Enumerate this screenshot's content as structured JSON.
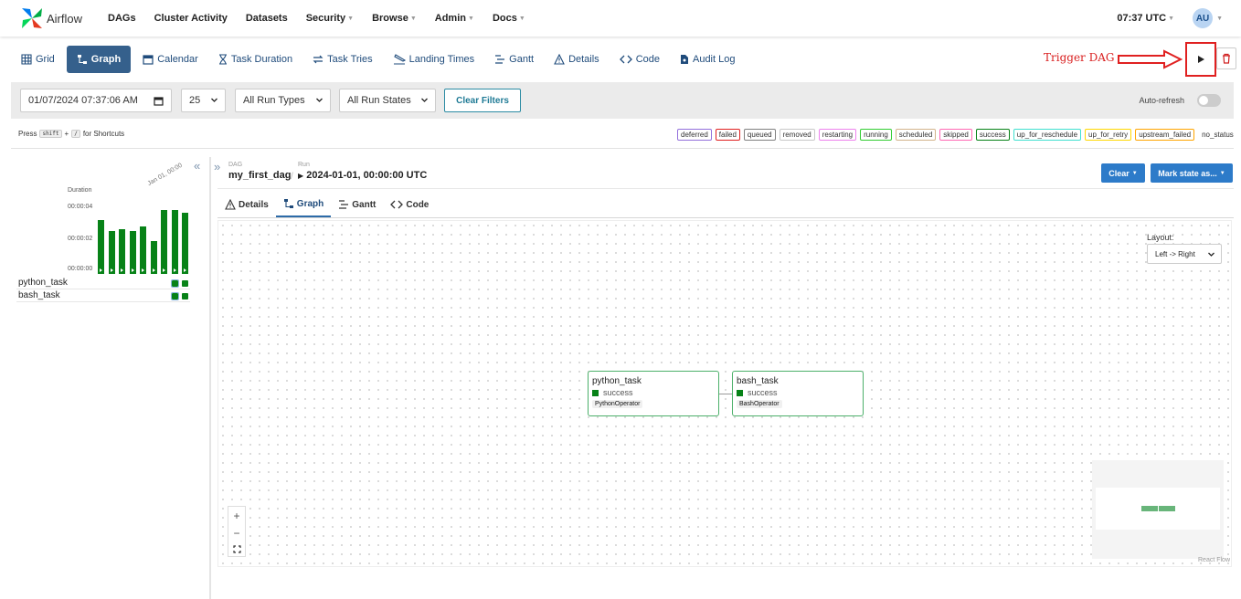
{
  "topnav": {
    "brand": "Airflow",
    "items": [
      {
        "label": "DAGs",
        "caret": false
      },
      {
        "label": "Cluster Activity",
        "caret": false
      },
      {
        "label": "Datasets",
        "caret": false
      },
      {
        "label": "Security",
        "caret": true
      },
      {
        "label": "Browse",
        "caret": true
      },
      {
        "label": "Admin",
        "caret": true
      },
      {
        "label": "Docs",
        "caret": true
      }
    ],
    "time": "07:37 UTC",
    "avatar": "AU"
  },
  "view_tabs": [
    {
      "label": "Grid",
      "icon": "grid-icon",
      "active": false
    },
    {
      "label": "Graph",
      "icon": "graph-icon",
      "active": true
    },
    {
      "label": "Calendar",
      "icon": "calendar-icon",
      "active": false
    },
    {
      "label": "Task Duration",
      "icon": "hourglass-icon",
      "active": false
    },
    {
      "label": "Task Tries",
      "icon": "retry-icon",
      "active": false
    },
    {
      "label": "Landing Times",
      "icon": "plane-landing-icon",
      "active": false
    },
    {
      "label": "Gantt",
      "icon": "gantt-icon",
      "active": false
    },
    {
      "label": "Details",
      "icon": "warning-triangle-icon",
      "active": false
    },
    {
      "label": "Code",
      "icon": "code-icon",
      "active": false
    },
    {
      "label": "Audit Log",
      "icon": "audit-file-icon",
      "active": false
    }
  ],
  "annotation": {
    "label": "Trigger DAG",
    "color": "#d91f1f"
  },
  "filters": {
    "date": "01/07/2024 07:37:06 AM",
    "num_runs": "25",
    "run_type": "All Run Types",
    "run_state": "All Run States",
    "clear_label": "Clear Filters",
    "auto_refresh": "Auto-refresh"
  },
  "shortcuts": {
    "press": "Press",
    "key1": "shift",
    "plus": "+",
    "key2": "/",
    "suffix": "for Shortcuts"
  },
  "legend": [
    {
      "label": "deferred",
      "color": "#9370db"
    },
    {
      "label": "failed",
      "color": "#e02020"
    },
    {
      "label": "queued",
      "color": "#808080"
    },
    {
      "label": "removed",
      "color": "#c8c8c8"
    },
    {
      "label": "restarting",
      "color": "#ee82ee"
    },
    {
      "label": "running",
      "color": "#32cd32"
    },
    {
      "label": "scheduled",
      "color": "#d2b48c"
    },
    {
      "label": "skipped",
      "color": "#ff69b4"
    },
    {
      "label": "success",
      "color": "#078217"
    },
    {
      "label": "up_for_reschedule",
      "color": "#40e0d0"
    },
    {
      "label": "up_for_retry",
      "color": "#ffd700"
    },
    {
      "label": "upstream_failed",
      "color": "#ffa500"
    }
  ],
  "legend_no_status": "no_status",
  "grid": {
    "duration_label": "Duration",
    "yticks": [
      "00:00:04",
      "00:00:02",
      "00:00:00"
    ],
    "date_label": "Jan 01, 00:00",
    "run_durations": [
      3.6,
      2.9,
      3.0,
      2.9,
      3.2,
      2.2,
      4.3,
      4.3,
      4.1
    ],
    "max_duration": 4.8,
    "tasks": [
      {
        "name": "python_task"
      },
      {
        "name": "bash_task"
      }
    ]
  },
  "breadcrumb": {
    "dag_small": "DAG",
    "dag_name": "my_first_dag",
    "run_small": "Run",
    "run_name": "2024-01-01, 00:00:00 UTC"
  },
  "actions": {
    "clear": "Clear",
    "mark": "Mark state as..."
  },
  "sub_tabs": [
    {
      "label": "Details",
      "icon": "warning-triangle-icon",
      "active": false
    },
    {
      "label": "Graph",
      "icon": "graph-icon",
      "active": true
    },
    {
      "label": "Gantt",
      "icon": "gantt-icon",
      "active": false
    },
    {
      "label": "Code",
      "icon": "code-icon",
      "active": false
    }
  ],
  "graph": {
    "layout_label": "Layout:",
    "layout_value": "Left -> Right",
    "nodes": [
      {
        "name": "python_task",
        "status": "success",
        "operator": "PythonOperator"
      },
      {
        "name": "bash_task",
        "status": "success",
        "operator": "BashOperator"
      }
    ],
    "zoom_in": "+",
    "zoom_out": "−",
    "react_flow": "React Flow"
  }
}
